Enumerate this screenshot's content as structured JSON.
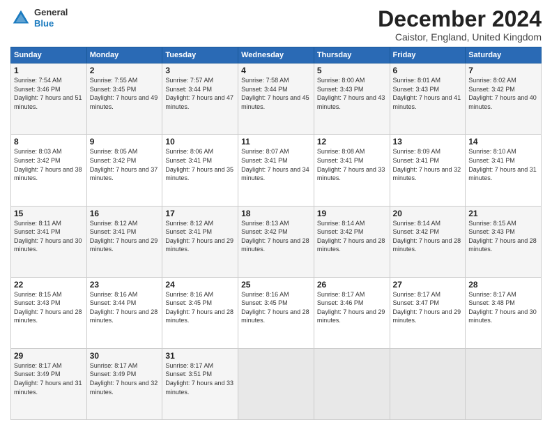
{
  "header": {
    "logo": {
      "line1": "General",
      "line2": "Blue"
    },
    "title": "December 2024",
    "subtitle": "Caistor, England, United Kingdom"
  },
  "calendar": {
    "days_of_week": [
      "Sunday",
      "Monday",
      "Tuesday",
      "Wednesday",
      "Thursday",
      "Friday",
      "Saturday"
    ],
    "weeks": [
      [
        {
          "day": 1,
          "sunrise": "7:54 AM",
          "sunset": "3:46 PM",
          "daylight": "7 hours and 51 minutes."
        },
        {
          "day": 2,
          "sunrise": "7:55 AM",
          "sunset": "3:45 PM",
          "daylight": "7 hours and 49 minutes."
        },
        {
          "day": 3,
          "sunrise": "7:57 AM",
          "sunset": "3:44 PM",
          "daylight": "7 hours and 47 minutes."
        },
        {
          "day": 4,
          "sunrise": "7:58 AM",
          "sunset": "3:44 PM",
          "daylight": "7 hours and 45 minutes."
        },
        {
          "day": 5,
          "sunrise": "8:00 AM",
          "sunset": "3:43 PM",
          "daylight": "7 hours and 43 minutes."
        },
        {
          "day": 6,
          "sunrise": "8:01 AM",
          "sunset": "3:43 PM",
          "daylight": "7 hours and 41 minutes."
        },
        {
          "day": 7,
          "sunrise": "8:02 AM",
          "sunset": "3:42 PM",
          "daylight": "7 hours and 40 minutes."
        }
      ],
      [
        {
          "day": 8,
          "sunrise": "8:03 AM",
          "sunset": "3:42 PM",
          "daylight": "7 hours and 38 minutes."
        },
        {
          "day": 9,
          "sunrise": "8:05 AM",
          "sunset": "3:42 PM",
          "daylight": "7 hours and 37 minutes."
        },
        {
          "day": 10,
          "sunrise": "8:06 AM",
          "sunset": "3:41 PM",
          "daylight": "7 hours and 35 minutes."
        },
        {
          "day": 11,
          "sunrise": "8:07 AM",
          "sunset": "3:41 PM",
          "daylight": "7 hours and 34 minutes."
        },
        {
          "day": 12,
          "sunrise": "8:08 AM",
          "sunset": "3:41 PM",
          "daylight": "7 hours and 33 minutes."
        },
        {
          "day": 13,
          "sunrise": "8:09 AM",
          "sunset": "3:41 PM",
          "daylight": "7 hours and 32 minutes."
        },
        {
          "day": 14,
          "sunrise": "8:10 AM",
          "sunset": "3:41 PM",
          "daylight": "7 hours and 31 minutes."
        }
      ],
      [
        {
          "day": 15,
          "sunrise": "8:11 AM",
          "sunset": "3:41 PM",
          "daylight": "7 hours and 30 minutes."
        },
        {
          "day": 16,
          "sunrise": "8:12 AM",
          "sunset": "3:41 PM",
          "daylight": "7 hours and 29 minutes."
        },
        {
          "day": 17,
          "sunrise": "8:12 AM",
          "sunset": "3:41 PM",
          "daylight": "7 hours and 29 minutes."
        },
        {
          "day": 18,
          "sunrise": "8:13 AM",
          "sunset": "3:42 PM",
          "daylight": "7 hours and 28 minutes."
        },
        {
          "day": 19,
          "sunrise": "8:14 AM",
          "sunset": "3:42 PM",
          "daylight": "7 hours and 28 minutes."
        },
        {
          "day": 20,
          "sunrise": "8:14 AM",
          "sunset": "3:42 PM",
          "daylight": "7 hours and 28 minutes."
        },
        {
          "day": 21,
          "sunrise": "8:15 AM",
          "sunset": "3:43 PM",
          "daylight": "7 hours and 28 minutes."
        }
      ],
      [
        {
          "day": 22,
          "sunrise": "8:15 AM",
          "sunset": "3:43 PM",
          "daylight": "7 hours and 28 minutes."
        },
        {
          "day": 23,
          "sunrise": "8:16 AM",
          "sunset": "3:44 PM",
          "daylight": "7 hours and 28 minutes."
        },
        {
          "day": 24,
          "sunrise": "8:16 AM",
          "sunset": "3:45 PM",
          "daylight": "7 hours and 28 minutes."
        },
        {
          "day": 25,
          "sunrise": "8:16 AM",
          "sunset": "3:45 PM",
          "daylight": "7 hours and 28 minutes."
        },
        {
          "day": 26,
          "sunrise": "8:17 AM",
          "sunset": "3:46 PM",
          "daylight": "7 hours and 29 minutes."
        },
        {
          "day": 27,
          "sunrise": "8:17 AM",
          "sunset": "3:47 PM",
          "daylight": "7 hours and 29 minutes."
        },
        {
          "day": 28,
          "sunrise": "8:17 AM",
          "sunset": "3:48 PM",
          "daylight": "7 hours and 30 minutes."
        }
      ],
      [
        {
          "day": 29,
          "sunrise": "8:17 AM",
          "sunset": "3:49 PM",
          "daylight": "7 hours and 31 minutes."
        },
        {
          "day": 30,
          "sunrise": "8:17 AM",
          "sunset": "3:49 PM",
          "daylight": "7 hours and 32 minutes."
        },
        {
          "day": 31,
          "sunrise": "8:17 AM",
          "sunset": "3:51 PM",
          "daylight": "7 hours and 33 minutes."
        },
        null,
        null,
        null,
        null
      ]
    ]
  }
}
